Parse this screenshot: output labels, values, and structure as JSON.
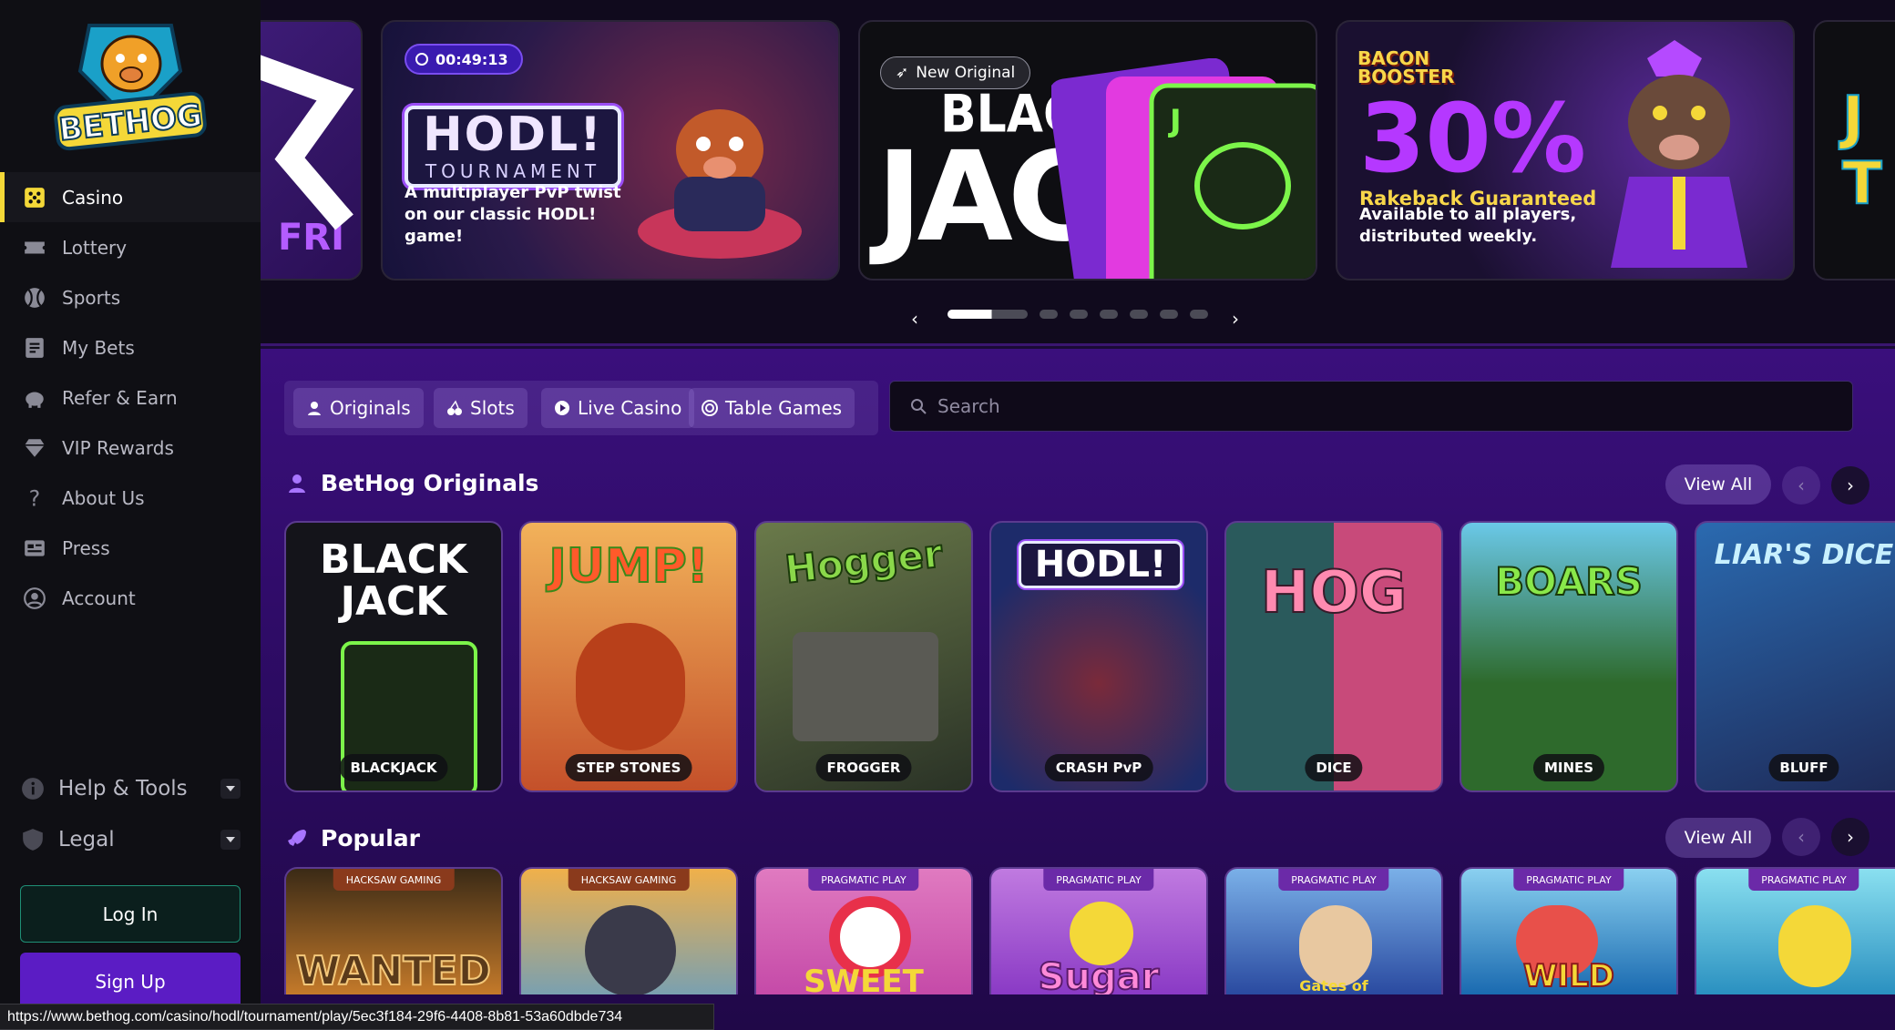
{
  "brand": {
    "logo_text": "BETHOG",
    "accent": "#f4d838",
    "purple": "#5b1cc4"
  },
  "sidebar": {
    "items": [
      {
        "label": "Casino",
        "icon": "dice-icon",
        "active": true
      },
      {
        "label": "Lottery",
        "icon": "ticket-icon"
      },
      {
        "label": "Sports",
        "icon": "ball-icon"
      },
      {
        "label": "My Bets",
        "icon": "list-icon"
      },
      {
        "label": "Refer & Earn",
        "icon": "piggy-bank-icon"
      },
      {
        "label": "VIP Rewards",
        "icon": "diamond-icon"
      },
      {
        "label": "About Us",
        "icon": "question-icon"
      },
      {
        "label": "Press",
        "icon": "newspaper-icon"
      },
      {
        "label": "Account",
        "icon": "user-circle-icon"
      }
    ],
    "help_label": "Help & Tools",
    "legal_label": "Legal",
    "login_label": "Log In",
    "signup_label": "Sign Up"
  },
  "banners": {
    "partial_left": "FRI",
    "hodl": {
      "timer": "00:49:13",
      "logo": "HODL!",
      "logo_sub": "TOURNAMENT",
      "subtitle": "A multiplayer PvP twist on our classic HODL! game!"
    },
    "blackjack": {
      "badge": "New Original",
      "line1": "BLACK",
      "line2": "JACK"
    },
    "bacon": {
      "brand": "BACON BOOSTER",
      "percent": "30%",
      "headline": "Rakeback Guaranteed",
      "subtitle": "Available to all players, distributed weekly."
    },
    "partial_right": "J T"
  },
  "filters": {
    "tabs": [
      {
        "label": "Originals",
        "icon": "user-icon"
      },
      {
        "label": "Slots",
        "icon": "cherry-icon"
      },
      {
        "label": "Live Casino",
        "icon": "play-icon"
      },
      {
        "label": "Table Games",
        "icon": "chip-icon"
      }
    ],
    "search_placeholder": "Search"
  },
  "originals": {
    "title": "BetHog Originals",
    "view_all": "View All",
    "games": [
      {
        "label": "BLACKJACK",
        "art": "BLACK JACK",
        "bg": "#1a1a22"
      },
      {
        "label": "STEP STONES",
        "art": "JUMP!",
        "bg": "#b3402a"
      },
      {
        "label": "FROGGER",
        "art": "Hogger",
        "bg": "#3c4a3a"
      },
      {
        "label": "CRASH PvP",
        "art": "HODL!",
        "bg": "#1d2b6a"
      },
      {
        "label": "DICE",
        "art": "HOG",
        "bg": "#2a5a5c"
      },
      {
        "label": "MINES",
        "art": "BOARS",
        "bg": "#2e6a2c"
      },
      {
        "label": "BLUFF",
        "art": "LIAR'S DICE",
        "bg": "#1e3a78"
      }
    ]
  },
  "popular": {
    "title": "Popular",
    "view_all": "View All",
    "games": [
      {
        "provider": "HACKSAW GAMING",
        "art": "WANTED",
        "bg": "#3a2a16"
      },
      {
        "provider": "HACKSAW GAMING",
        "art": "",
        "bg": "#c47a2a"
      },
      {
        "provider": "PRAGMATIC PLAY",
        "art": "SWEET",
        "bg": "#c54aa8"
      },
      {
        "provider": "PRAGMATIC PLAY",
        "art": "Sugar",
        "bg": "#8a3ac5"
      },
      {
        "provider": "PRAGMATIC PLAY",
        "art": "Gates of",
        "bg": "#2a4aa0"
      },
      {
        "provider": "PRAGMATIC PLAY",
        "art": "WILD",
        "bg": "#1a6ab0"
      },
      {
        "provider": "PRAGMATIC PLAY",
        "art": "",
        "bg": "#2a90c0"
      }
    ]
  },
  "status_url": "https://www.bethog.com/casino/hodl/tournament/play/5ec3f184-29f6-4408-8b81-53a60dbde734"
}
